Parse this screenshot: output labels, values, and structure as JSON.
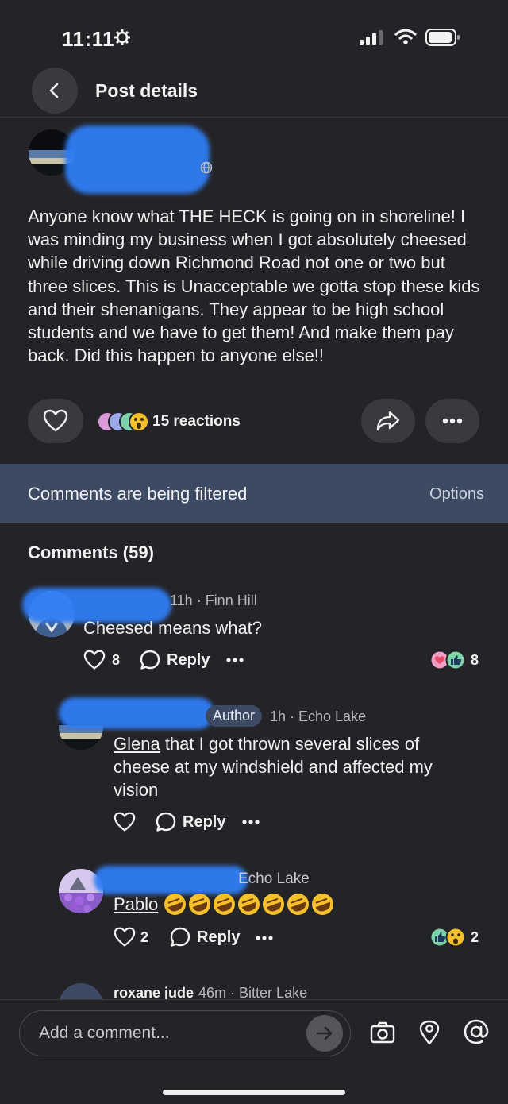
{
  "status_bar": {
    "time": "11:11"
  },
  "header": {
    "title": "Post details"
  },
  "post": {
    "body": "Anyone know what THE HECK is going on in shoreline! I was minding my business when I got absolutely cheesed while driving down Richmond Road not one or two but three slices. This is Unacceptable we gotta stop these kids and their shenanigans. They appear to be high school students and we have to get them! And make them pay back. Did this happen to anyone else!!",
    "reactions_label": "15 reactions"
  },
  "filter_banner": {
    "text": "Comments are being filtered",
    "options_label": "Options"
  },
  "comments_heading": "Comments (59)",
  "comments": [
    {
      "meta": "11h · Finn Hill",
      "text": "Cheesed means what?",
      "like_count": "8",
      "reply_label": "Reply",
      "reaction_count": "8"
    },
    {
      "badge": "Author",
      "meta": "1h · Echo Lake",
      "mention": "Glena",
      "text": " that I got thrown several slices of cheese at my  windshield and affected my vision",
      "reply_label": "Reply"
    },
    {
      "meta": "Echo Lake",
      "mention": "Pablo",
      "like_count": "2",
      "reply_label": "Reply",
      "reaction_count": "2"
    },
    {
      "author": "roxane jude",
      "meta": "46m · Bitter Lake"
    }
  ],
  "composer": {
    "placeholder": "Add a comment..."
  },
  "colors": {
    "background": "#242428",
    "banner": "#3d4a63",
    "accent_blue": "#2f7df5",
    "button": "#3a3a3e"
  }
}
